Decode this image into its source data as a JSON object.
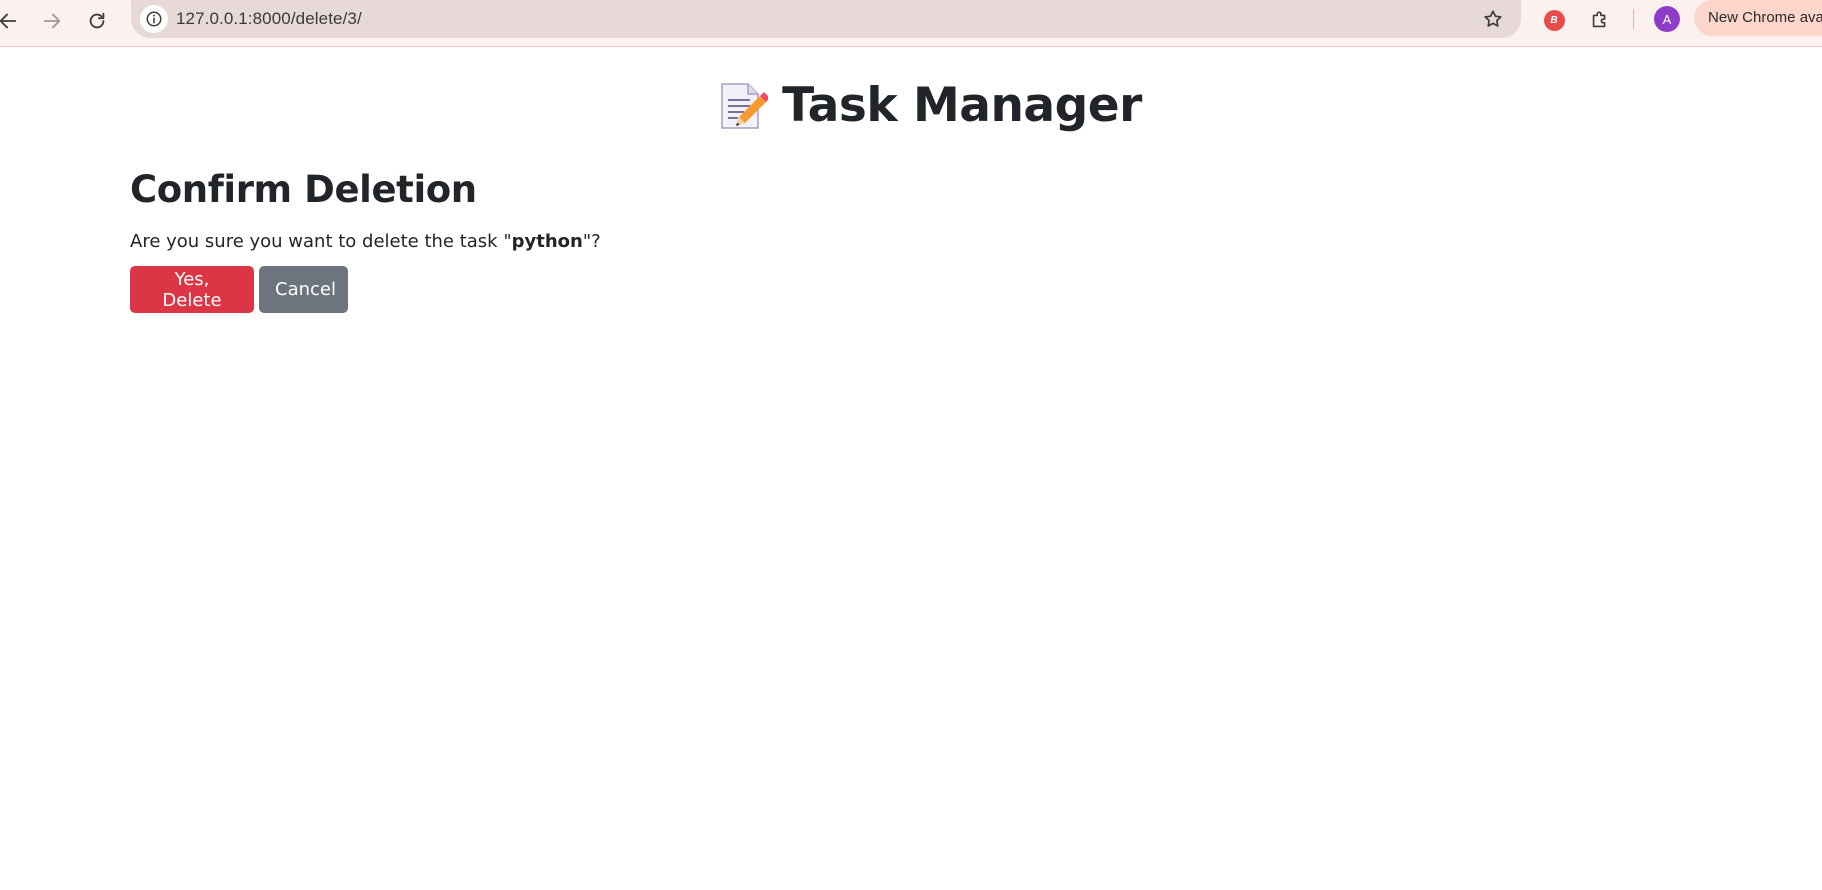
{
  "browser": {
    "url": "127.0.0.1:8000/delete/3/",
    "update_chip": "New Chrome ava",
    "avatar_initial": "A",
    "extension_badge": "B"
  },
  "page": {
    "app_title": "Task Manager",
    "heading": "Confirm Deletion",
    "confirm_prefix": "Are you sure you want to delete the task \"",
    "task_name": "python",
    "confirm_suffix": "\"?",
    "delete_button": "Yes, Delete",
    "cancel_button": "Cancel"
  },
  "colors": {
    "danger": "#dc3545",
    "secondary": "#6c757d",
    "text": "#212529"
  },
  "icons": {
    "back": "arrow-left-icon",
    "forward": "arrow-right-icon",
    "reload": "reload-icon",
    "site_info": "info-icon",
    "bookmark": "star-icon",
    "extensions": "puzzle-icon",
    "title": "memo-icon"
  }
}
